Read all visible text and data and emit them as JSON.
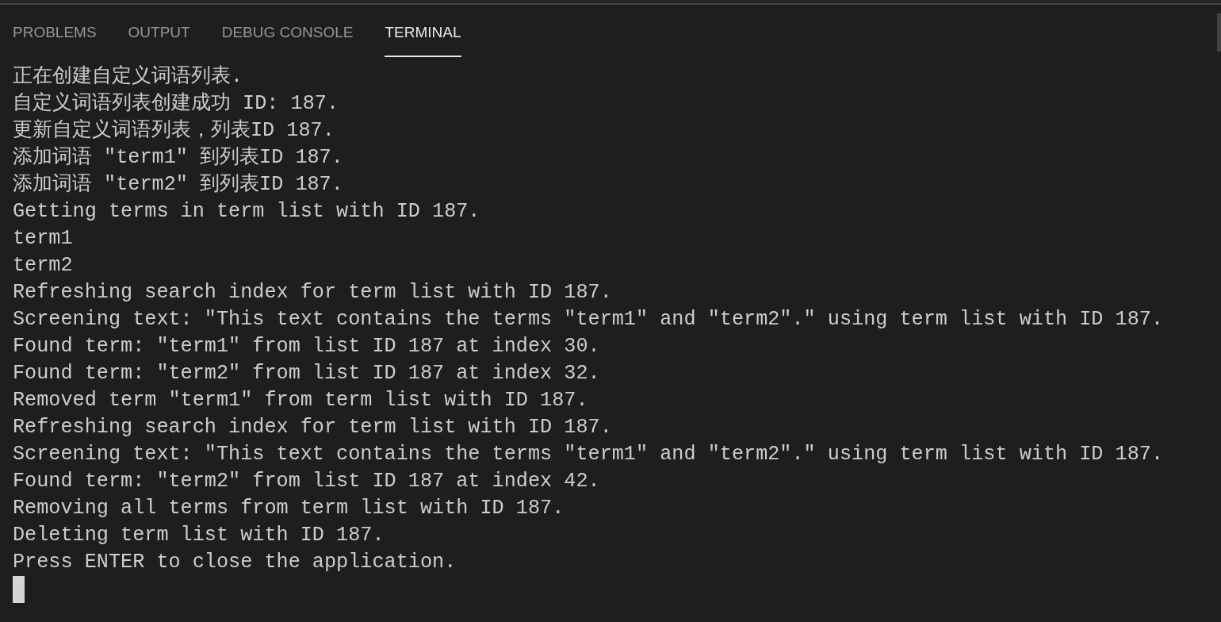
{
  "tabs": [
    {
      "label": "PROBLEMS",
      "selected": false
    },
    {
      "label": "OUTPUT",
      "selected": false
    },
    {
      "label": "DEBUG CONSOLE",
      "selected": false
    },
    {
      "label": "TERMINAL",
      "selected": true
    }
  ],
  "terminal": {
    "lines": [
      "正在创建自定义词语列表.",
      "自定义词语列表创建成功 ID: 187.",
      "更新自定义词语列表，列表ID 187.",
      "添加词语 \"term1\" 到列表ID 187.",
      "添加词语 \"term2\" 到列表ID 187.",
      "Getting terms in term list with ID 187.",
      "term1",
      "term2",
      "Refreshing search index for term list with ID 187.",
      "Screening text: \"This text contains the terms \"term1\" and \"term2\".\" using term list with ID 187.",
      "Found term: \"term1\" from list ID 187 at index 30.",
      "Found term: \"term2\" from list ID 187 at index 32.",
      "Removed term \"term1\" from term list with ID 187.",
      "Refreshing search index for term list with ID 187.",
      "Screening text: \"This text contains the terms \"term1\" and \"term2\".\" using term list with ID 187.",
      "Found term: \"term2\" from list ID 187 at index 42.",
      "Removing all terms from term list with ID 187.",
      "Deleting term list with ID 187.",
      "Press ENTER to close the application."
    ]
  }
}
